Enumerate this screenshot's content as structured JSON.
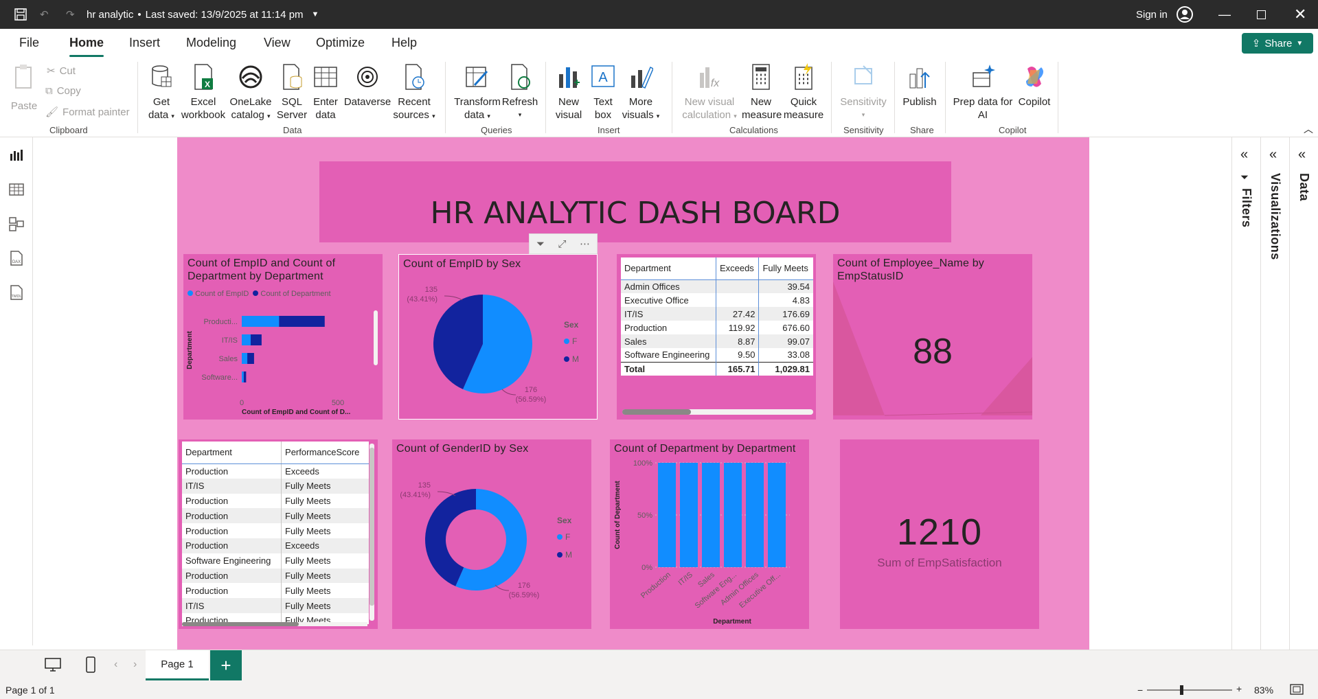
{
  "titlebar": {
    "title": "hr analytic",
    "bullet": "•",
    "saved": "Last saved: 13/9/2025 at 11:14 pm",
    "sign_in": "Sign in"
  },
  "menu": [
    "File",
    "Home",
    "Insert",
    "Modeling",
    "View",
    "Optimize",
    "Help"
  ],
  "share_label": "Share",
  "ribbon": {
    "clipboard": {
      "paste": "Paste",
      "cut": "Cut",
      "copy": "Copy",
      "format_painter": "Format painter",
      "group": "Clipboard"
    },
    "data": {
      "get_data": [
        "Get",
        "data"
      ],
      "excel": [
        "Excel",
        "workbook"
      ],
      "onelake": [
        "OneLake",
        "catalog"
      ],
      "sql": [
        "SQL",
        "Server"
      ],
      "enter": [
        "Enter",
        "data"
      ],
      "dataverse": "Dataverse",
      "recent": [
        "Recent",
        "sources"
      ],
      "group": "Data"
    },
    "queries": {
      "transform": [
        "Transform",
        "data"
      ],
      "refresh": "Refresh",
      "group": "Queries"
    },
    "insert": {
      "new_visual": [
        "New",
        "visual"
      ],
      "text_box": [
        "Text",
        "box"
      ],
      "more_visuals": [
        "More",
        "visuals"
      ],
      "group": "Insert"
    },
    "calculations": {
      "new_visual_calc": [
        "New visual",
        "calculation"
      ],
      "new_measure": [
        "New",
        "measure"
      ],
      "quick_measure": [
        "Quick",
        "measure"
      ],
      "group": "Calculations"
    },
    "sensitivity": {
      "label": "Sensitivity",
      "group": "Sensitivity"
    },
    "share": {
      "publish": "Publish",
      "group": "Share"
    },
    "copilot": {
      "prep": [
        "Prep data for",
        "AI"
      ],
      "copilot": "Copilot",
      "group": "Copilot"
    }
  },
  "dashboard": {
    "title": "HR ANALYTIC DASH BOARD",
    "bar_visual": {
      "title": [
        "Count of EmpID and Count of",
        "Department by Department"
      ],
      "legend": [
        "Count of EmpID",
        "Count of Department"
      ],
      "yaxis": "Department",
      "xaxis": "Count of EmpID and Count of D...",
      "ticks": [
        "0",
        "500"
      ]
    },
    "pie_visual": {
      "title": "Count of EmpID by Sex",
      "legend_title": "Sex",
      "legend": [
        "F",
        "M"
      ],
      "label_m": [
        "135",
        "(43.41%)"
      ],
      "label_f": [
        "176",
        "(56.59%)"
      ]
    },
    "matrix": {
      "headers": [
        "Department",
        "Exceeds",
        "Fully Meets"
      ],
      "rows": [
        [
          "Admin Offices",
          "",
          "39.54"
        ],
        [
          "Executive Office",
          "",
          "4.83"
        ],
        [
          "IT/IS",
          "27.42",
          "176.69"
        ],
        [
          "Production",
          "119.92",
          "676.60"
        ],
        [
          "Sales",
          "8.87",
          "99.07"
        ],
        [
          "Software Engineering",
          "9.50",
          "33.08"
        ]
      ],
      "total": [
        "Total",
        "165.71",
        "1,029.81"
      ]
    },
    "card1": {
      "title": [
        "Count of Employee_Name by",
        "EmpStatusID"
      ],
      "value": "88"
    },
    "perf_table": {
      "headers": [
        "Department",
        "PerformanceScore"
      ],
      "rows": [
        [
          "Production",
          "Exceeds"
        ],
        [
          "IT/IS",
          "Fully Meets"
        ],
        [
          "Production",
          "Fully Meets"
        ],
        [
          "Production",
          "Fully Meets"
        ],
        [
          "Production",
          "Fully Meets"
        ],
        [
          "Production",
          "Exceeds"
        ],
        [
          "Software Engineering",
          "Fully Meets"
        ],
        [
          "Production",
          "Fully Meets"
        ],
        [
          "Production",
          "Fully Meets"
        ],
        [
          "IT/IS",
          "Fully Meets"
        ],
        [
          "Production",
          "Fully Meets"
        ]
      ]
    },
    "donut_visual": {
      "title": "Count of GenderID by Sex",
      "legend_title": "Sex",
      "legend": [
        "F",
        "M"
      ],
      "label_m": [
        "135",
        "(43.41%)"
      ],
      "label_f": [
        "176",
        "(56.59%)"
      ]
    },
    "col_visual": {
      "title": "Count of Department by Department",
      "yaxis": "Count of Department",
      "xaxis": "Department",
      "yticks": [
        "100%",
        "50%",
        "0%"
      ]
    },
    "card2": {
      "value": "1210",
      "label": "Sum of EmpSatisfaction"
    }
  },
  "chart_data": [
    {
      "type": "bar",
      "title": "Count of EmpID and Count of Department by Department",
      "categories": [
        "Producti...",
        "IT/IS",
        "Sales",
        "Software..."
      ],
      "series": [
        {
          "name": "Count of EmpID",
          "values": [
            209,
            50,
            31,
            11
          ]
        },
        {
          "name": "Count of Department",
          "values": [
            209,
            50,
            31,
            11
          ]
        }
      ],
      "xlabel": "Count of EmpID and Count of D...",
      "ylabel": "Department",
      "xlim": [
        0,
        500
      ]
    },
    {
      "type": "pie",
      "title": "Count of EmpID by Sex",
      "categories": [
        "F",
        "M"
      ],
      "values": [
        176,
        135
      ],
      "percent": [
        56.59,
        43.41
      ]
    },
    {
      "type": "pie",
      "title": "Count of GenderID by Sex",
      "categories": [
        "F",
        "M"
      ],
      "values": [
        176,
        135
      ],
      "percent": [
        56.59,
        43.41
      ],
      "donut": true
    },
    {
      "type": "bar",
      "title": "Count of Department by Department",
      "categories": [
        "Production",
        "IT/IS",
        "Sales",
        "Software Eng...",
        "Admin Offices",
        "Executive Off..."
      ],
      "values": [
        100,
        100,
        100,
        100,
        100,
        100
      ],
      "ylabel": "Count of Department",
      "xlabel": "Department",
      "ylim": [
        0,
        100
      ],
      "unit": "%"
    }
  ],
  "colors": {
    "light_blue": "#118dff",
    "dark_blue": "#12239e",
    "panel": "#e35fb5",
    "page": "#ef8bc9",
    "accent": "#117865"
  },
  "tabs": {
    "page": "Page 1",
    "add": "+"
  },
  "status": {
    "page_info": "Page 1 of 1",
    "zoom": "83%"
  },
  "panes": {
    "filters": "Filters",
    "visualizations": "Visualizations",
    "data": "Data"
  }
}
